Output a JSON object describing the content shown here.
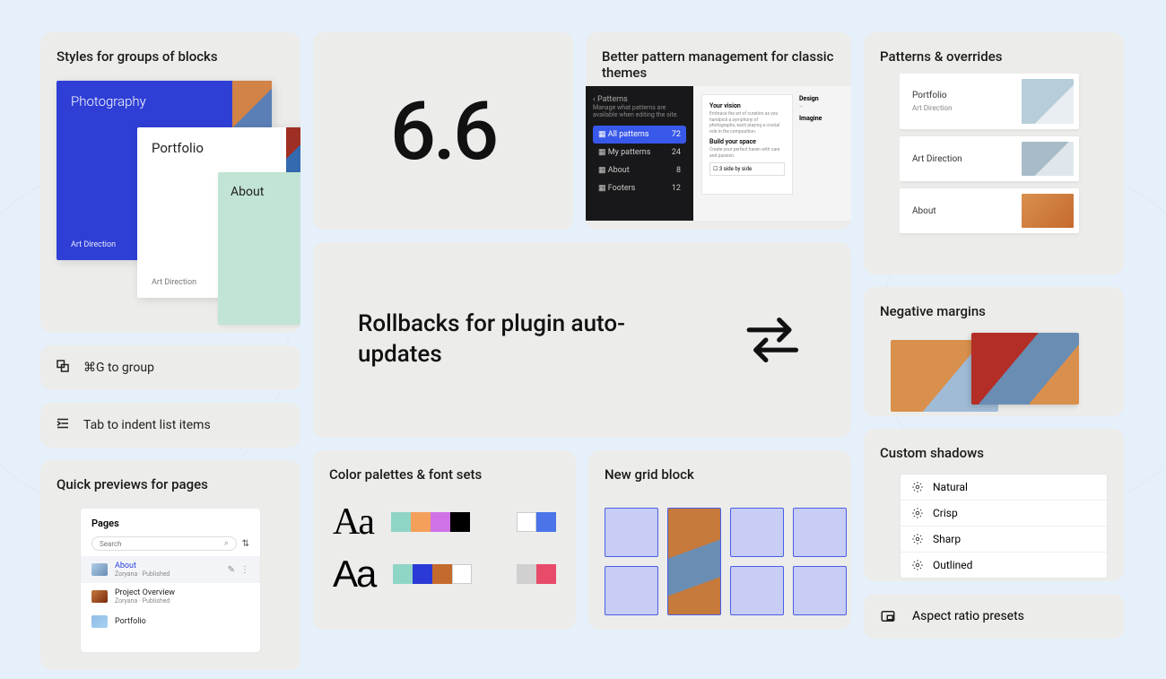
{
  "version": "6.6",
  "cards": {
    "styles_groups": "Styles for groups of blocks",
    "pattern_mgmt": "Better pattern management for classic themes",
    "patterns_overrides": "Patterns & overrides",
    "rollback": "Rollbacks for plugin auto-updates",
    "neg_margins": "Negative margins",
    "palettes": "Color palettes & font sets",
    "gridblock": "New grid block",
    "shadows": "Custom shadows",
    "previews": "Quick previews for pages",
    "aspect": "Aspect ratio presets"
  },
  "tips": {
    "group": "⌘G to group",
    "indent": "Tab to indent list items"
  },
  "stack": {
    "photography": "Photography",
    "portfolio": "Portfolio",
    "about": "About",
    "art_direction": "Art Direction"
  },
  "pattern_panel": {
    "back": "Patterns",
    "desc": "Manage what patterns are available when editing the site.",
    "items": [
      {
        "label": "All patterns",
        "count": "72",
        "active": true
      },
      {
        "label": "My patterns",
        "count": "24"
      },
      {
        "label": "About",
        "count": "8"
      },
      {
        "label": "Footers",
        "count": "12"
      }
    ],
    "doc": {
      "h1": "Your vision",
      "p1": "Embrace the art of curation as you handpick a symphony of photographs, each playing a crucial role in the composition.",
      "h2": "Build your space",
      "p2": "Create your perfect haven with care and passion.",
      "h3": "Design",
      "h4": "Imagine",
      "label": "3 side by side"
    }
  },
  "pages_panel": {
    "title": "Pages",
    "search": "Search",
    "rows": [
      {
        "title": "About",
        "author": "Zoryana",
        "status": "Published",
        "active": true
      },
      {
        "title": "Project Overview",
        "author": "Zoryana",
        "status": "Published"
      },
      {
        "title": "Portfolio",
        "author": "",
        "status": ""
      }
    ]
  },
  "palettes": {
    "aa": "Aa",
    "row1": [
      "#8fd5c6",
      "#f5a05a",
      "#cf72e6",
      "#000000"
    ],
    "row1b": [
      "#ffffff",
      "#4a74e8"
    ],
    "row2": [
      "#8fd5c6",
      "#2b3ad6",
      "#c56a2d",
      "#ffffff"
    ],
    "row2b": [
      "#d0d0d0",
      "#e84a6a"
    ]
  },
  "overrides": [
    {
      "title": "Portfolio",
      "sub": "Art Direction"
    },
    {
      "title": "Art Direction"
    },
    {
      "title": "About"
    }
  ],
  "shadows": [
    "Natural",
    "Crisp",
    "Sharp",
    "Outlined"
  ]
}
